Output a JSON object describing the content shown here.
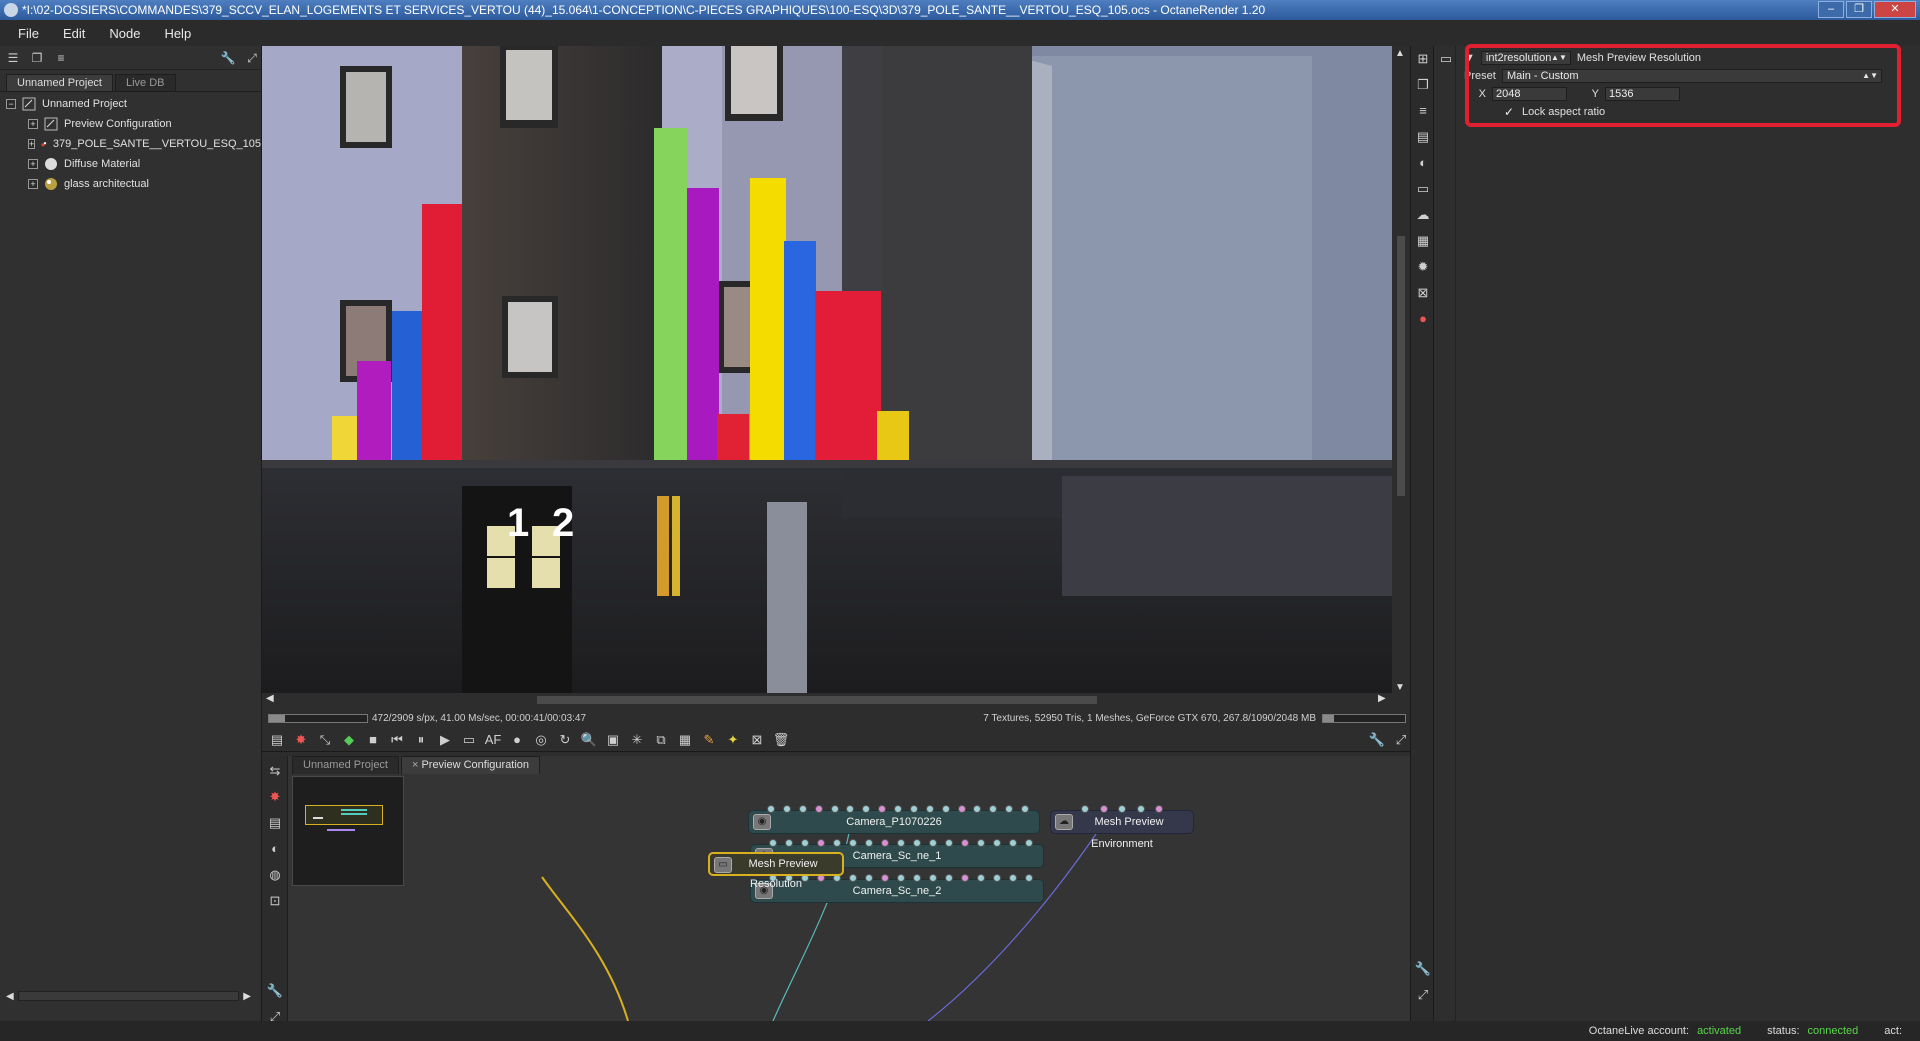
{
  "window": {
    "title": "*I:\\02-DOSSIERS\\COMMANDES\\379_SCCV_ELAN_LOGEMENTS ET SERVICES_VERTOU (44)_15.064\\1-CONCEPTION\\C-PIECES GRAPHIQUES\\100-ESQ\\3D\\379_POLE_SANTE__VERTOU_ESQ_105.ocs - OctaneRender 1.20",
    "minimize": "–",
    "maximize": "❐",
    "close": "✕"
  },
  "menu": [
    "File",
    "Edit",
    "Node",
    "Help"
  ],
  "outliner": {
    "tabs": [
      "Unnamed Project",
      "Live DB"
    ],
    "root": "Unnamed Project",
    "items": [
      {
        "label": "Preview Configuration",
        "icon": "node-graph-icon"
      },
      {
        "label": "379_POLE_SANTE__VERTOU_ESQ_105",
        "icon": "mesh-icon"
      },
      {
        "label": "Diffuse Material",
        "icon": "material-sphere-icon"
      },
      {
        "label": "glass architectual",
        "icon": "glass-material-icon"
      }
    ]
  },
  "render_status": {
    "progress": 0.162,
    "samples": "472/2909 s/px, 41.00 Ms/sec, 00:00:41/00:03:47",
    "stats": "7 Textures, 52950 Tris, 1 Meshes, GeForce GTX 670, 267.8/1090/2048 MB",
    "memory_fraction": 0.13
  },
  "render_scene": {
    "door_number_1": "1",
    "door_number_2": "2"
  },
  "node_editor": {
    "tabs": [
      "Unnamed Project",
      "Preview Configuration"
    ],
    "tab_close": "×",
    "nodes": {
      "camera_main": "Camera_P1070226",
      "camera_1": "Camera_Sc_ne_1",
      "camera_2": "Camera_Sc_ne_2",
      "environment": "Mesh Preview Environment",
      "resolution": "Mesh Preview Resolution"
    }
  },
  "inspector": {
    "node_type": "int2resolution",
    "node_name": "Mesh Preview Resolution",
    "preset_label": "Preset",
    "preset_value": "Main - Custom",
    "x_label": "X",
    "x_value": "2048",
    "y_label": "Y",
    "y_value": "1536",
    "lock_label": "Lock aspect ratio",
    "lock_checked": true
  },
  "status_bar": {
    "account_label": "OctaneLive account:",
    "account_value": "activated",
    "status_label": "status:",
    "status_value": "connected",
    "act_label": "act:"
  },
  "colors": {
    "highlight": "#e02030",
    "green": "#59d64a",
    "node_selected": "#d7b11f"
  }
}
